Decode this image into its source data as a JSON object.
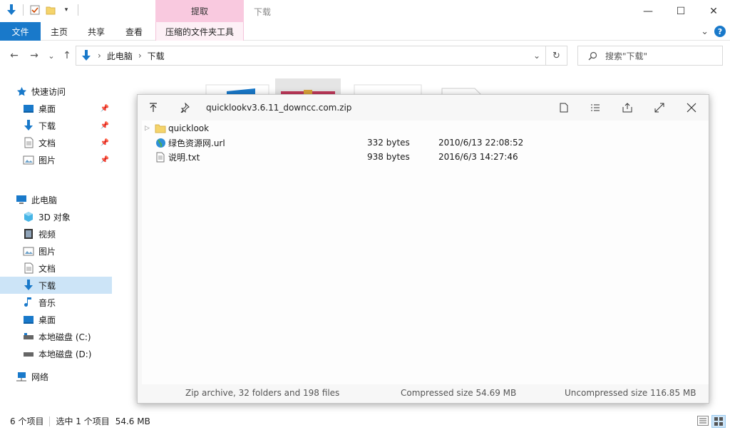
{
  "titlebar": {
    "context_tab_group": "提取",
    "window_title": "下载",
    "minimize": "—",
    "maximize": "☐",
    "close": "✕"
  },
  "ribbon": {
    "tabs": [
      "文件",
      "主页",
      "共享",
      "查看",
      "压缩的文件夹工具"
    ],
    "expand": "⌄",
    "help": "?"
  },
  "nav": {
    "back": "←",
    "forward": "→",
    "recent": "⌄",
    "up": "↑",
    "breadcrumb": [
      "此电脑",
      "下载"
    ],
    "separator": "›",
    "dropdown": "⌄",
    "refresh": "↻",
    "search_placeholder": "搜索\"下载\""
  },
  "sidebar": {
    "quick_access": {
      "label": "快速访问",
      "items": [
        {
          "label": "桌面",
          "icon": "desktop-icon",
          "pinned": true
        },
        {
          "label": "下载",
          "icon": "download-icon",
          "pinned": true
        },
        {
          "label": "文档",
          "icon": "document-icon",
          "pinned": true
        },
        {
          "label": "图片",
          "icon": "pictures-icon",
          "pinned": true
        }
      ]
    },
    "this_pc": {
      "label": "此电脑",
      "items": [
        {
          "label": "3D 对象",
          "icon": "3d-objects-icon"
        },
        {
          "label": "视频",
          "icon": "video-icon"
        },
        {
          "label": "图片",
          "icon": "pictures-icon"
        },
        {
          "label": "文档",
          "icon": "document-icon"
        },
        {
          "label": "下载",
          "icon": "download-icon",
          "selected": true
        },
        {
          "label": "音乐",
          "icon": "music-icon"
        },
        {
          "label": "桌面",
          "icon": "desktop-icon"
        },
        {
          "label": "本地磁盘 (C:)",
          "icon": "drive-icon"
        },
        {
          "label": "本地磁盘 (D:)",
          "icon": "drive-icon"
        }
      ]
    },
    "network": {
      "label": "网络",
      "icon": "network-icon"
    }
  },
  "statusbar": {
    "item_count": "6 个项目",
    "selected": "选中 1 个项目",
    "size": "54.6 MB"
  },
  "quicklook": {
    "title": "quicklookv3.6.11_downcc.com.zip",
    "files": [
      {
        "name": "quicklook",
        "type": "folder",
        "size": "",
        "date": "",
        "expandable": true
      },
      {
        "name": "绿色资源网.url",
        "type": "url",
        "size": "332 bytes",
        "date": "2010/6/13 22:08:52"
      },
      {
        "name": "说明.txt",
        "type": "txt",
        "size": "938 bytes",
        "date": "2016/6/3 14:27:46"
      }
    ],
    "footer": {
      "summary": "Zip archive, 32 folders and 198 files",
      "compressed": "Compressed size 54.69 MB",
      "uncompressed": "Uncompressed size 116.85 MB"
    }
  },
  "colors": {
    "accent": "#1979ca",
    "context_tab": "#f9c9df",
    "selection": "#cce4f7"
  }
}
